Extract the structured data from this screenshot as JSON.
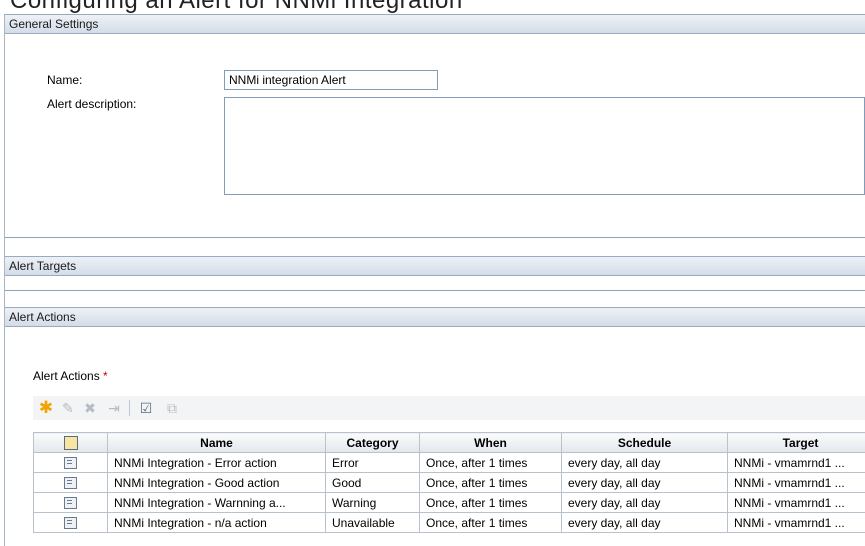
{
  "page": {
    "top_banner": "Configuring an Alert for NNMi Integration"
  },
  "general_settings": {
    "header": "General Settings",
    "name_label": "Name:",
    "name_value": "NNMi integration Alert",
    "description_label": "Alert description:",
    "description_value": ""
  },
  "alert_targets": {
    "header": "Alert Targets"
  },
  "alert_actions": {
    "header": "Alert Actions",
    "list_label": "Alert Actions",
    "required_mark": "*",
    "toolbar": [
      {
        "name": "new-action-icon",
        "glyph": "✱",
        "enabled": true
      },
      {
        "name": "edit-action-icon",
        "glyph": "✎",
        "enabled": false
      },
      {
        "name": "delete-action-icon",
        "glyph": "✖",
        "enabled": false
      },
      {
        "name": "move-action-icon",
        "glyph": "⇥",
        "enabled": false
      },
      {
        "name": "select-all-icon",
        "glyph": "☑",
        "enabled": true
      },
      {
        "name": "copy-action-icon",
        "glyph": "⧉",
        "enabled": false
      }
    ],
    "columns": [
      "Name",
      "Category",
      "When",
      "Schedule",
      "Target"
    ],
    "rows": [
      {
        "name": "NNMi Integration - Error action",
        "category": "Error",
        "when": "Once, after 1 times",
        "schedule": "every day, all day",
        "target": "NNMi - vmamrnd1 ..."
      },
      {
        "name": "NNMi Integration - Good action",
        "category": "Good",
        "when": "Once, after 1 times",
        "schedule": "every day, all day",
        "target": "NNMi - vmamrnd1 ..."
      },
      {
        "name": "NNMi Integration - Warnning a...",
        "category": "Warning",
        "when": "Once, after 1 times",
        "schedule": "every day, all day",
        "target": "NNMi - vmamrnd1 ..."
      },
      {
        "name": "NNMi Integration - n/a action",
        "category": "Unavailable",
        "when": "Once, after 1 times",
        "schedule": "every day, all day",
        "target": "NNMi - vmamrnd1 ..."
      }
    ]
  }
}
